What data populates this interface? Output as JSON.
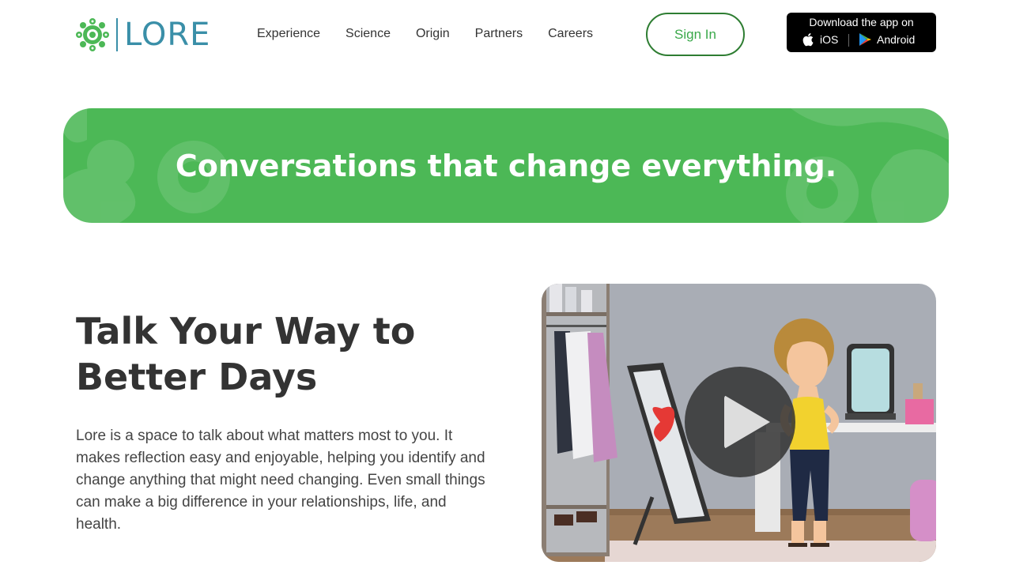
{
  "brand": {
    "name": "LORE",
    "color": "#3a8fa8",
    "icon": "lore-flower-icon"
  },
  "nav": {
    "items": [
      "Experience",
      "Science",
      "Origin",
      "Partners",
      "Careers"
    ]
  },
  "header": {
    "signin_label": "Sign In",
    "download": {
      "title": "Download the app on",
      "ios_label": "iOS",
      "android_label": "Android",
      "ios_icon": "apple-icon",
      "android_icon": "google-play-icon"
    }
  },
  "banner": {
    "text": "Conversations that change everything.",
    "color": "#4cb856"
  },
  "hero": {
    "title_line1": "Talk Your Way to",
    "title_line2": "Better Days",
    "body": "Lore is a space to talk about what matters most to you. It makes reflection easy and enjoyable, helping you identify and change anything that might need changing. Even small things can make a big difference in your relationships, life, and health."
  },
  "video": {
    "play_icon": "play-icon"
  },
  "colors": {
    "accent": "#3aa84a",
    "text": "#333333"
  }
}
